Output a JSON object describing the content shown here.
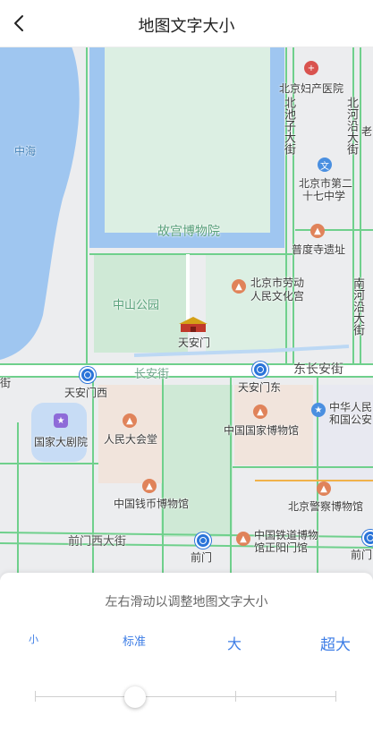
{
  "header": {
    "title": "地图文字大小",
    "back_icon": "chevron-left-icon"
  },
  "map": {
    "labels": {
      "zhonghai": "中海",
      "gugong": "故宫博物院",
      "zhongshan_park": "中山公园",
      "tiananmen": "天安门",
      "changan_street": "长安街",
      "dong_changan_street": "东长安街",
      "jie": "街",
      "tiananmen_west": "天安门西",
      "tiananmen_east": "天安门东",
      "national_theatre": "国家大剧院",
      "great_hall": "人民大会堂",
      "national_museum": "中国国家博物馆",
      "money_museum": "中国钱币博物馆",
      "police_museum": "北京警察博物馆",
      "qianmen_west_street": "前门西大街",
      "qianmen": "前门",
      "railway_museum_1": "中国铁道博物",
      "railway_museum_2": "馆正阳门馆",
      "qianmen_partial": "前门",
      "maternity_hospital": "北京妇产医院",
      "beichizi_street": "北池子大街",
      "beiheyan_street": "北河沿大街",
      "lao": "老",
      "school_1": "北京市第二",
      "school_2": "十七中学",
      "pudu_temple": "普度寺遗址",
      "culture_palace_1": "北京市劳动",
      "culture_palace_2": "人民文化宫",
      "nanheyan_street": "南河沿大街",
      "mfa_1": "中华人民",
      "mfa_2": "和国公安"
    },
    "colors": {
      "road": "#6fd08c",
      "water": "#9fc6f0",
      "park": "#cfe9d6",
      "block": "#f1e4dc"
    }
  },
  "panel": {
    "hint": "左右滑动以调整地图文字大小",
    "options": [
      "小",
      "标准",
      "大",
      "超大"
    ],
    "selected_index": 1
  }
}
